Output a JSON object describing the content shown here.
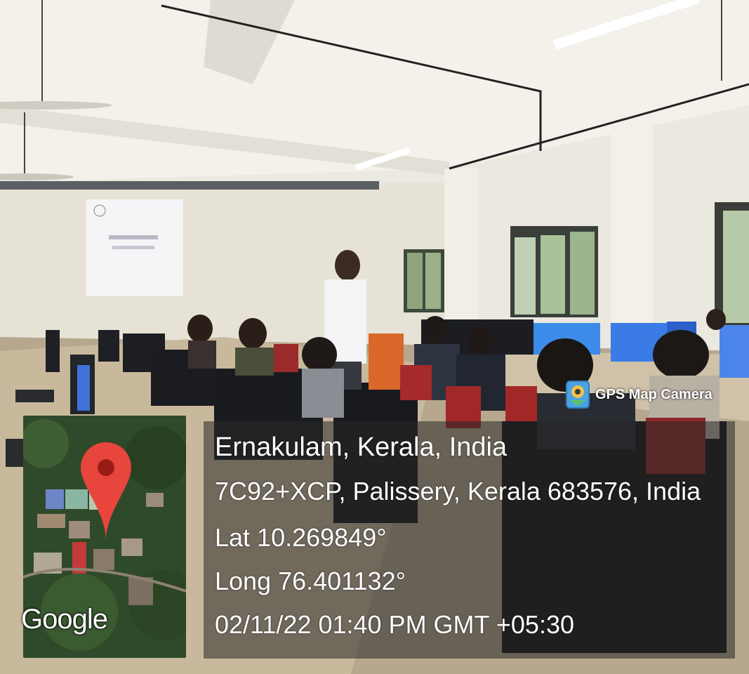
{
  "photo": {
    "scene": "computer-lab-classroom",
    "colors": {
      "wall": "#e9e6dc",
      "ceiling": "#f1efe8",
      "floor": "#c8b89a",
      "monitor": "#1b1d22",
      "screen_blue": "#2f6fe0",
      "chair": "#a52a2a"
    }
  },
  "projector_slide": {
    "title": "",
    "text": ""
  },
  "map": {
    "label": "Google",
    "pin_color": "#e8453c",
    "icon": "map-pin-icon"
  },
  "app_badge": {
    "label": "GPS Map Camera",
    "icon": "gps-map-camera-icon"
  },
  "geotag": {
    "city_line": "Ernakulam, Kerala, India",
    "address_line": "7C92+XCP, Palissery, Kerala 683576, India",
    "lat_line": "Lat 10.269849°",
    "long_line": "Long 76.401132°",
    "datetime_line": "02/11/22 01:40 PM GMT +05:30"
  }
}
